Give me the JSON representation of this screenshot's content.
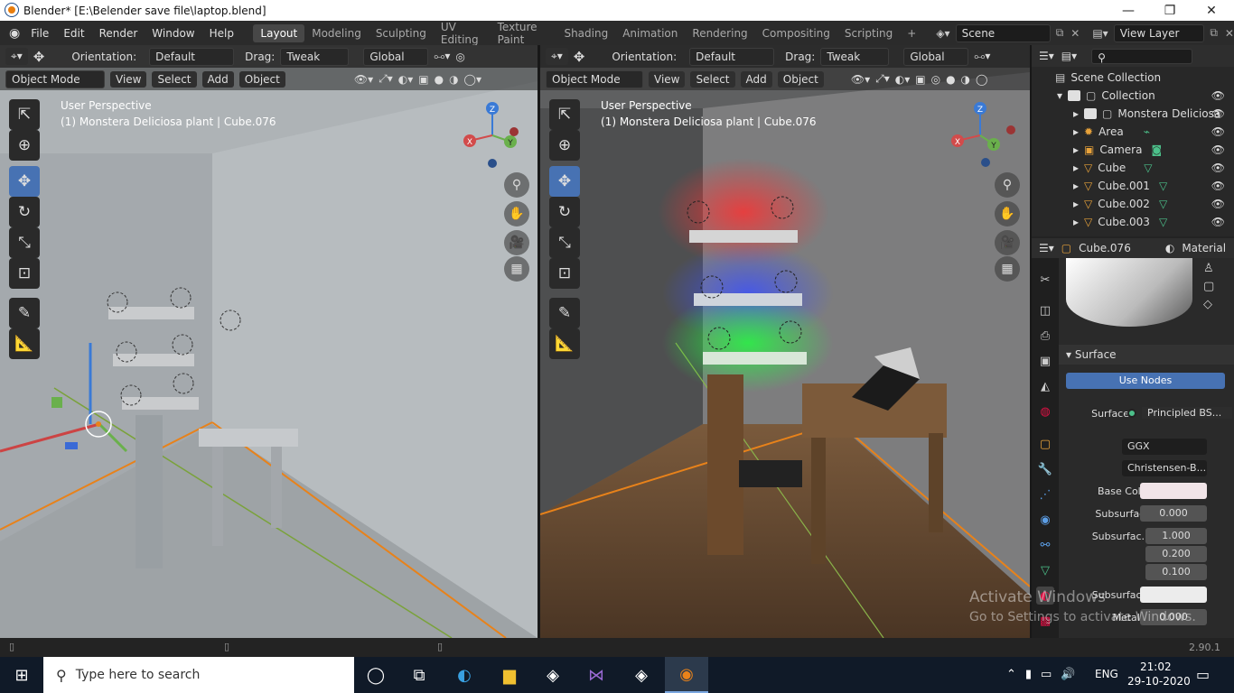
{
  "window": {
    "title": "Blender* [E:\\Belender save file\\laptop.blend]"
  },
  "menu": [
    "File",
    "Edit",
    "Render",
    "Window",
    "Help"
  ],
  "workspaces": [
    "Layout",
    "Modeling",
    "Sculpting",
    "UV Editing",
    "Texture Paint",
    "Shading",
    "Animation",
    "Rendering",
    "Compositing",
    "Scripting"
  ],
  "active_workspace": "Layout",
  "scene": "Scene",
  "view_layer": "View Layer",
  "toolbar": {
    "orientation_label": "Orientation:",
    "orientation_value": "Default",
    "drag_label": "Drag:",
    "drag_value": "Tweak",
    "transform": "Global"
  },
  "viewport_left": {
    "mode": "Object Mode",
    "menus": [
      "View",
      "Select",
      "Add",
      "Object"
    ],
    "line1": "User Perspective",
    "line2": "(1) Monstera Deliciosa plant | Cube.076"
  },
  "viewport_right": {
    "mode": "Object Mode",
    "menus": [
      "View",
      "Select",
      "Add",
      "Object"
    ],
    "line1": "User Perspective",
    "line2": "(1) Monstera Deliciosa plant | Cube.076"
  },
  "gizmo": {
    "x": "X",
    "y": "Y",
    "z": "Z"
  },
  "outliner": {
    "root": "Scene Collection",
    "items": [
      {
        "label": "Collection",
        "icon": "collection-icon"
      },
      {
        "label": "Monstera Deliciosa",
        "icon": "collection-icon"
      },
      {
        "label": "Area",
        "icon": "light-icon"
      },
      {
        "label": "Camera",
        "icon": "camera-icon"
      },
      {
        "label": "Cube",
        "icon": "mesh-icon"
      },
      {
        "label": "Cube.001",
        "icon": "mesh-icon"
      },
      {
        "label": "Cube.002",
        "icon": "mesh-icon"
      },
      {
        "label": "Cube.003",
        "icon": "mesh-icon"
      }
    ]
  },
  "properties": {
    "object": "Cube.076",
    "tab": "Material",
    "section": "Surface",
    "use_nodes": "Use Nodes",
    "surface_label": "Surface",
    "surface_value": "Principled BS...",
    "distribution": "GGX",
    "subsurface_method": "Christensen-B...",
    "rows": [
      {
        "label": "Base Color",
        "value": ""
      },
      {
        "label": "Subsurface",
        "value": "0.000"
      },
      {
        "label": "Subsurfac...",
        "value": "1.000"
      },
      {
        "label": "",
        "value": "0.200"
      },
      {
        "label": "",
        "value": "0.100"
      },
      {
        "label": "Subsurfac...",
        "value": ""
      },
      {
        "label": "Metallic",
        "value": "0.000"
      }
    ]
  },
  "watermark": {
    "line1": "Activate Windows",
    "line2": "Go to Settings to activate Windows."
  },
  "version": "2.90.1",
  "taskbar": {
    "search_placeholder": "Type here to search",
    "lang": "ENG",
    "time": "21:02",
    "date": "29-10-2020"
  }
}
